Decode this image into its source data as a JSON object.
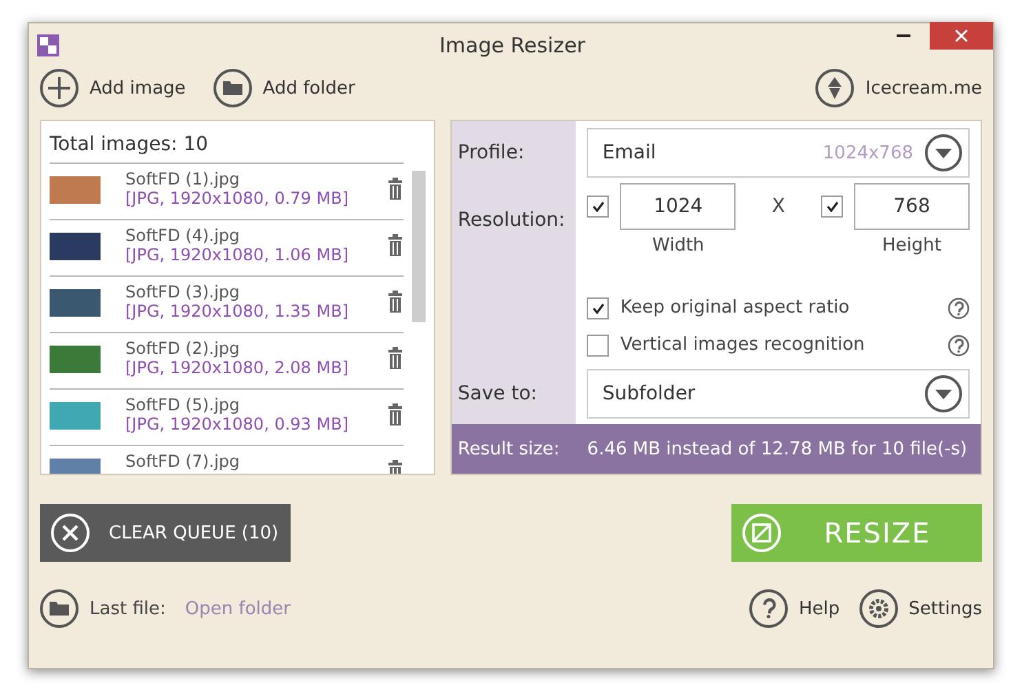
{
  "window": {
    "title": "Image Resizer"
  },
  "toolbar": {
    "add_image": "Add image",
    "add_folder": "Add folder",
    "site_link": "Icecream.me"
  },
  "queue": {
    "total": "Total images: 10",
    "files": [
      {
        "name": "SoftFD (1).jpg",
        "info": "[JPG, 1920x1080, 0.79 MB]",
        "color": "#c07a50"
      },
      {
        "name": "SoftFD (4).jpg",
        "info": "[JPG, 1920x1080, 1.06 MB]",
        "color": "#2a3a60"
      },
      {
        "name": "SoftFD (3).jpg",
        "info": "[JPG, 1920x1080, 1.35 MB]",
        "color": "#3a5870"
      },
      {
        "name": "SoftFD (2).jpg",
        "info": "[JPG, 1920x1080, 2.08 MB]",
        "color": "#3c7a3a"
      },
      {
        "name": "SoftFD (5).jpg",
        "info": "[JPG, 1920x1080, 0.93 MB]",
        "color": "#40a8b0"
      },
      {
        "name": "SoftFD (7).jpg",
        "color": "#6080a8"
      }
    ]
  },
  "settings": {
    "profile_label": "Profile:",
    "profile": "Email",
    "profile_size": "1024x768",
    "resolution_label": "Resolution:",
    "width": {
      "value": "1024",
      "label": "Width",
      "checked": true
    },
    "separator": "X",
    "height": {
      "value": "768",
      "label": "Height",
      "checked": true
    },
    "options": [
      {
        "label": "Keep original aspect ratio",
        "checked": true
      },
      {
        "label": "Vertical images recognition",
        "checked": false
      }
    ],
    "save_label": "Save to:",
    "save_to": "Subfolder",
    "result_label": "Result size:",
    "result": "6.46 MB instead of 12.78 MB for 10 file(-s)"
  },
  "clear_button": "CLEAR QUEUE (10)",
  "resize_button": "RESIZE",
  "footer": {
    "last_file": "Last file:",
    "open_folder": "Open folder",
    "help": "Help",
    "settings": "Settings"
  }
}
